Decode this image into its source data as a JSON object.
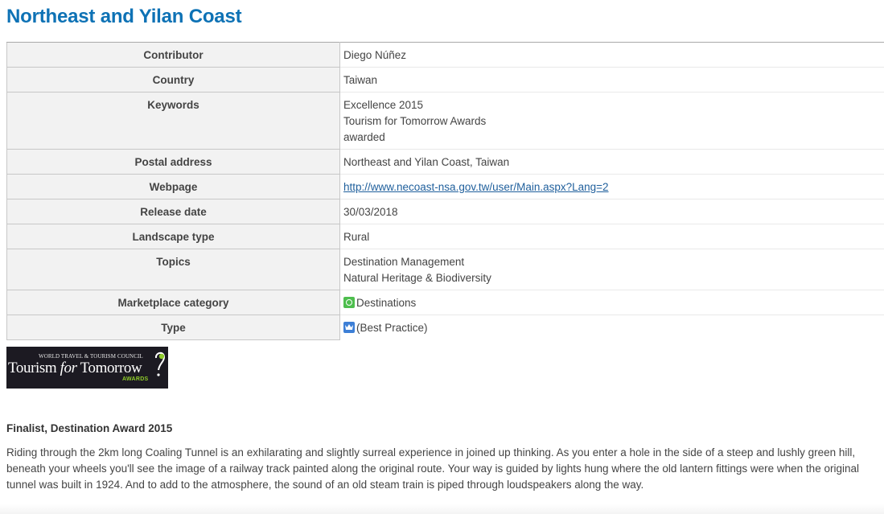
{
  "page": {
    "title": "Northeast and Yilan Coast"
  },
  "details": {
    "contributor": {
      "label": "Contributor",
      "value": "Diego Núñez"
    },
    "country": {
      "label": "Country",
      "value": "Taiwan"
    },
    "keywords": {
      "label": "Keywords",
      "values": [
        "Excellence 2015",
        "Tourism for Tomorrow Awards",
        "awarded"
      ]
    },
    "postal_address": {
      "label": "Postal address",
      "value": "Northeast and Yilan Coast, Taiwan"
    },
    "webpage": {
      "label": "Webpage",
      "value": "http://www.necoast-nsa.gov.tw/user/Main.aspx?Lang=2"
    },
    "release_date": {
      "label": "Release date",
      "value": "30/03/2018"
    },
    "landscape_type": {
      "label": "Landscape type",
      "value": "Rural"
    },
    "topics": {
      "label": "Topics",
      "values": [
        "Destination Management",
        "Natural Heritage & Biodiversity"
      ]
    },
    "marketplace_category": {
      "label": "Marketplace category",
      "value": "Destinations",
      "icon": "destinations-icon"
    },
    "type": {
      "label": "Type",
      "value": "(Best Practice)",
      "icon": "crown-icon"
    }
  },
  "logo": {
    "top_text": "WORLD TRAVEL & TOURISM COUNCIL",
    "main_text_1": "Tourism ",
    "main_text_for": "for",
    "main_text_2": " Tomorrow",
    "awards_text": "AWARDS",
    "background": "#1c1a22",
    "accent": "#8fcc2a"
  },
  "award": {
    "title": "Finalist, Destination Award 2015",
    "description": "Riding through the 2km long Coaling Tunnel is an exhilarating and slightly surreal experience in joined up thinking. As you enter a hole in the side of a steep and lushly green hill, beneath your wheels you'll see the image of a railway track painted along the original route. Your way is guided by lights hung where the old lantern fittings were when the original tunnel was built in 1924. And to add to the atmosphere, the sound of an old steam train is piped through loudspeakers along the way."
  },
  "colors": {
    "title": "#0e72b5",
    "link": "#1f5f9c",
    "key_background": "#f2f2f2"
  }
}
